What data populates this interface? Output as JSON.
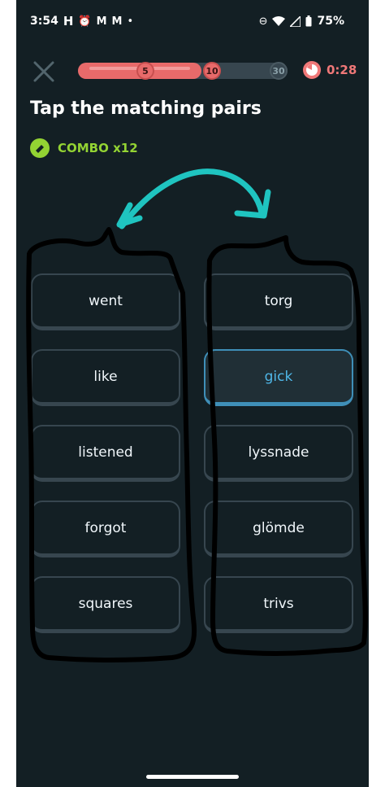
{
  "status": {
    "time": "3:54",
    "battery": "75%",
    "icons": [
      "h-icon",
      "alarm-icon",
      "mail-icon",
      "mail-icon",
      "dot-icon",
      "dnd-icon",
      "wifi-icon",
      "signal-icon",
      "battery-icon"
    ]
  },
  "progress": {
    "fraction": 0.59,
    "milestones": [
      "5",
      "10",
      "30"
    ]
  },
  "timer": "0:28",
  "title": "Tap the matching pairs",
  "combo": "COMBO x12",
  "left_words": [
    "went",
    "like",
    "listened",
    "forgot",
    "squares"
  ],
  "right_words": [
    "torg",
    "gick",
    "lyssnade",
    "glömde",
    "trivs"
  ],
  "selected": "gick",
  "colors": {
    "background": "#131f24",
    "card_border": "#37464f",
    "selected": "#4fb7e8",
    "progress": "#e86a6a",
    "combo": "#93d333",
    "annotation_arrow": "#1fc4c0",
    "annotation_outline": "#000000"
  }
}
